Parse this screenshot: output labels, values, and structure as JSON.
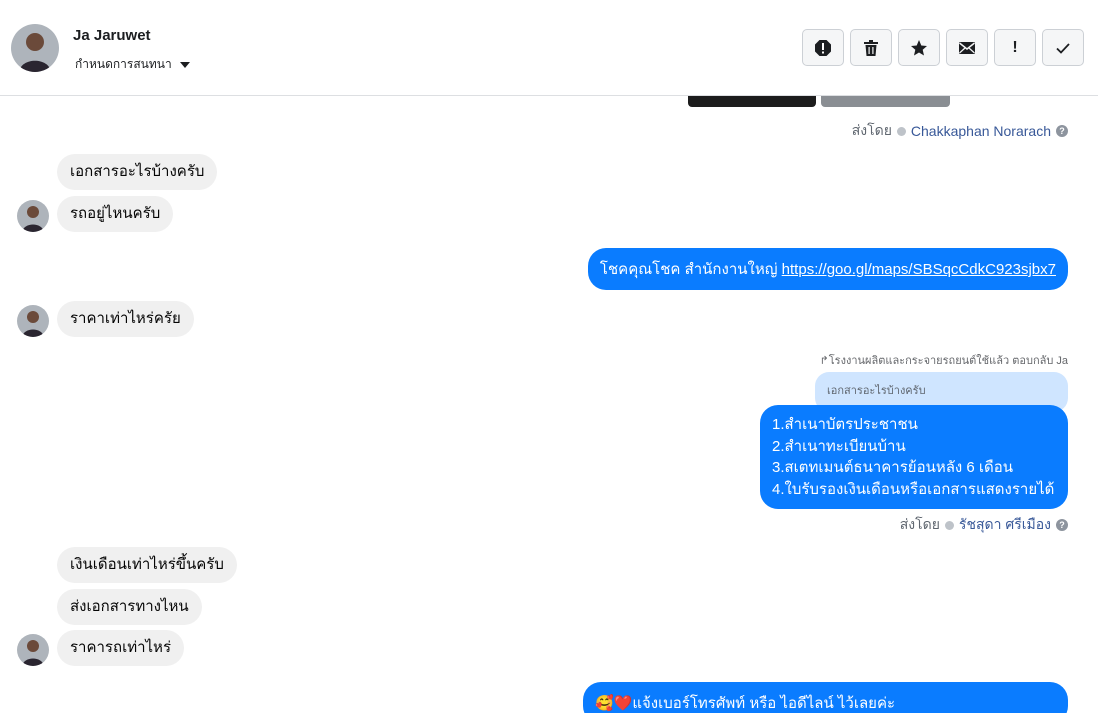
{
  "header": {
    "name": "Ja Jaruwet",
    "subtitle": "กำหนดการสนทนา"
  },
  "toolbar": {
    "icons": [
      "spam-icon",
      "trash-icon",
      "star-icon",
      "envelope-icon",
      "exclamation-icon",
      "check-icon"
    ],
    "exclamation_label": "!"
  },
  "messages": {
    "sent_by_1": {
      "label": "ส่งโดย",
      "who": "Chakkaphan Norarach"
    },
    "in_1": "เอกสารอะไรบ้างครับ",
    "in_2": "รถอยู่ไหนครับ",
    "out_1": {
      "text": "โชคคุณโชค สำนักงานใหญ่ ",
      "link": "https://goo.gl/maps/SBSqcCdkC923sjbx7"
    },
    "in_3": "ราคาเท่าไหร่ครัย",
    "reply_note": "↱โรงงานผลิตและกระจายรถยนต์ใช้แล้ว ตอบกลับ Ja",
    "reply_quote": "เอกสารอะไรบ้างครับ",
    "list_lines": [
      "1.สำเนาบัตรประชาชน",
      "2.สำเนาทะเบียนบ้าน",
      "3.สเตทเมนต์ธนาคารย้อนหลัง 6 เดือน",
      "4.ใบรับรองเงินเดือนหรือเอกสารแสดงรายได้"
    ],
    "sent_by_2": {
      "label": "ส่งโดย",
      "who": "รัชสุดา ศรีเมือง"
    },
    "in_4": "เงินเดือนเท่าไหร่ขึ้นครับ",
    "in_5": "ส่งเอกสารทางไหน",
    "in_6": "ราคารถเท่าไหร่",
    "out_2": "🥰❤️แจ้งเบอร์โทรศัพท์ หรือ ไอดีไลน์  ไว้เลยค่ะ"
  },
  "colors": {
    "sent_bubble": "#0a7cff",
    "received_bubble": "#f0f0f0",
    "reply_quote_bg": "#cfe5ff",
    "link_blue": "#385898"
  }
}
